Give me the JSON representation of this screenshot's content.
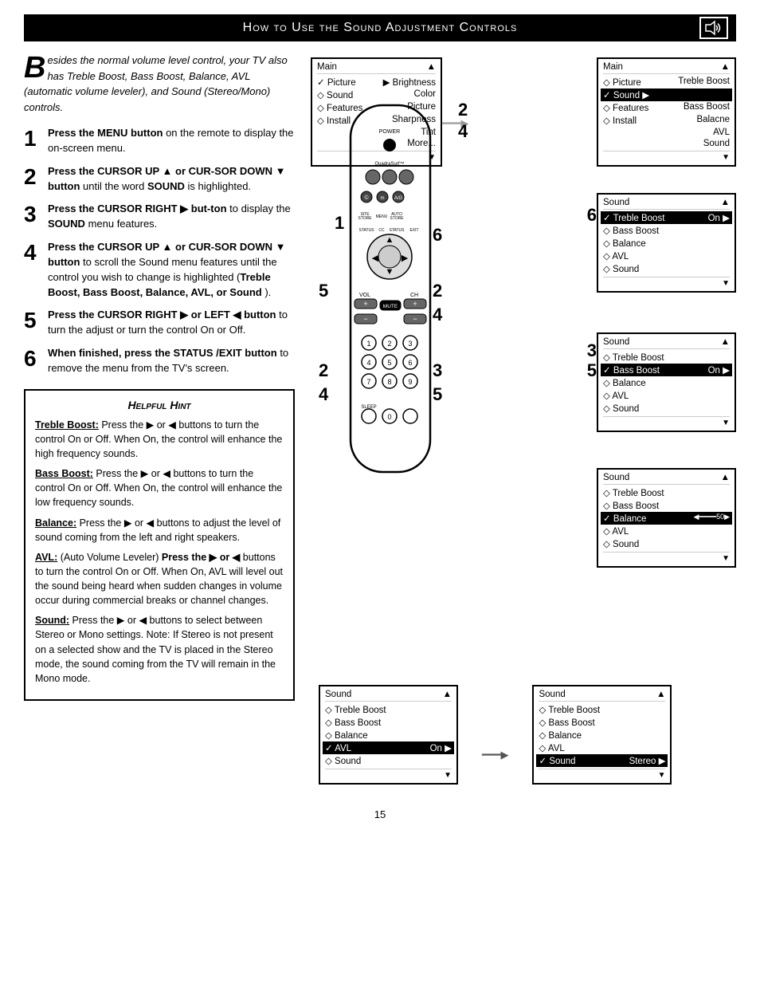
{
  "header": {
    "title": "How to Use the Sound Adjustment Controls",
    "icon_label": "sound-icon"
  },
  "intro": {
    "drop_cap": "B",
    "text": "esides the normal volume level control, your TV also has Treble Boost, Bass Boost, Balance, AVL (automatic volume leveler), and Sound (Stereo/Mono) controls."
  },
  "steps": [
    {
      "num": "1",
      "bold": "Press the MENU button",
      "rest": " on the remote to display the on-screen menu."
    },
    {
      "num": "2",
      "bold": "Press the CURSOR UP ▲ or CUR-SOR DOWN ▼ button",
      "rest": " until the word SOUND is highlighted."
    },
    {
      "num": "3",
      "bold": "Press the CURSOR RIGHT ▶ but-ton",
      "rest": " to display the SOUND menu features."
    },
    {
      "num": "4",
      "bold": "Press the CURSOR UP ▲ or CUR-SOR DOWN ▼ button",
      "rest": " to scroll the Sound menu features until the control you wish to change is highlighted (Treble Boost, Bass Boost, Balance, AVL, or Sound )."
    },
    {
      "num": "5",
      "bold": "Press the CURSOR RIGHT ▶ or LEFT ◀ button",
      "rest": " to turn the adjust or turn the control On or Off."
    },
    {
      "num": "6",
      "bold": "When finished, press the STATUS /EXIT button",
      "rest": " to remove the menu from the TV's screen."
    }
  ],
  "hint": {
    "title": "Helpful Hint",
    "items": [
      {
        "label": "Treble Boost:",
        "text": " Press the ▶ or ◀ buttons to turn the control On or Off. When On, the control will enhance the high frequency sounds."
      },
      {
        "label": "Bass Boost:",
        "text": " Press the ▶ or ◀ buttons to turn the control On or Off. When On, the control will enhance the low frequency sounds."
      },
      {
        "label": "Balance:",
        "text": " Press the ▶ or ◀ buttons to adjust the level of sound coming from the left and right speakers."
      },
      {
        "label": "AVL:",
        "text": " (Auto Volume Leveler) Press the ▶ or ◀ buttons to turn the control On or Off. When On, AVL will level out the sound being heard when sudden changes in volume occur during commercial breaks or channel changes."
      },
      {
        "label": "Sound:",
        "text": " Press the ▶ or ◀ buttons to select between Stereo or Mono settings. Note: If Stereo is not present on a selected show and the TV is placed in the Stereo mode, the sound coming from the TV will remain in the Mono mode."
      }
    ]
  },
  "menus": {
    "main_menu_1": {
      "title": "Main",
      "items": [
        {
          "label": "Picture",
          "value": "Brightness",
          "type": "arrow-right",
          "selected": false
        },
        {
          "label": "Sound",
          "value": "Color",
          "type": "diamond",
          "selected": false
        },
        {
          "label": "Features",
          "value": "Picture",
          "type": "diamond",
          "selected": false
        },
        {
          "label": "Install",
          "value": "Sharpness",
          "type": "diamond",
          "selected": false
        },
        {
          "label": "",
          "value": "Tint",
          "type": "",
          "selected": false
        },
        {
          "label": "",
          "value": "More...",
          "type": "",
          "selected": false
        }
      ]
    },
    "main_menu_2": {
      "title": "Main",
      "items": [
        {
          "label": "Picture",
          "value": "",
          "type": "diamond",
          "selected": false
        },
        {
          "label": "Sound",
          "value": "",
          "type": "checkmark",
          "selected": true
        },
        {
          "label": "Features",
          "value": "Treble Boost",
          "type": "diamond",
          "selected": false
        },
        {
          "label": "Install",
          "value": "Bass Boost",
          "type": "diamond",
          "selected": false
        },
        {
          "label": "",
          "value": "Balacne",
          "type": "",
          "selected": false
        },
        {
          "label": "",
          "value": "AVL",
          "type": "",
          "selected": false
        },
        {
          "label": "",
          "value": "Sound",
          "type": "",
          "selected": false
        }
      ]
    },
    "sound_menu_1": {
      "title": "Sound",
      "items": [
        {
          "label": "Treble Boost",
          "value": "On ▶",
          "type": "checkmark",
          "selected": true
        },
        {
          "label": "Bass Boost",
          "value": "",
          "type": "diamond",
          "selected": false
        },
        {
          "label": "Balance",
          "value": "",
          "type": "diamond",
          "selected": false
        },
        {
          "label": "AVL",
          "value": "",
          "type": "diamond",
          "selected": false
        },
        {
          "label": "Sound",
          "value": "",
          "type": "diamond",
          "selected": false
        }
      ]
    },
    "sound_menu_2": {
      "title": "Sound",
      "items": [
        {
          "label": "Treble Boost",
          "value": "",
          "type": "diamond",
          "selected": false
        },
        {
          "label": "Bass Boost",
          "value": "On ▶",
          "type": "checkmark",
          "selected": true
        },
        {
          "label": "Balance",
          "value": "",
          "type": "diamond",
          "selected": false
        },
        {
          "label": "AVL",
          "value": "",
          "type": "diamond",
          "selected": false
        },
        {
          "label": "Sound",
          "value": "",
          "type": "diamond",
          "selected": false
        }
      ]
    },
    "sound_menu_3": {
      "title": "Sound",
      "items": [
        {
          "label": "Treble Boost",
          "value": "",
          "type": "diamond",
          "selected": false
        },
        {
          "label": "Bass Boost",
          "value": "",
          "type": "diamond",
          "selected": false
        },
        {
          "label": "Balance",
          "value": "◀━━━━━━50▶",
          "type": "checkmark",
          "selected": true
        },
        {
          "label": "AVL",
          "value": "",
          "type": "diamond",
          "selected": false
        },
        {
          "label": "Sound",
          "value": "",
          "type": "diamond",
          "selected": false
        }
      ]
    },
    "sound_menu_avl": {
      "title": "Sound",
      "items": [
        {
          "label": "Treble Boost",
          "value": "",
          "type": "diamond",
          "selected": false
        },
        {
          "label": "Bass Boost",
          "value": "",
          "type": "diamond",
          "selected": false
        },
        {
          "label": "Balance",
          "value": "",
          "type": "diamond",
          "selected": false
        },
        {
          "label": "AVL",
          "value": "On ▶",
          "type": "checkmark",
          "selected": true
        },
        {
          "label": "Sound",
          "value": "",
          "type": "diamond",
          "selected": false
        }
      ]
    },
    "sound_menu_sound": {
      "title": "Sound",
      "items": [
        {
          "label": "Treble Boost",
          "value": "",
          "type": "diamond",
          "selected": false
        },
        {
          "label": "Bass Boost",
          "value": "",
          "type": "diamond",
          "selected": false
        },
        {
          "label": "Balance",
          "value": "",
          "type": "diamond",
          "selected": false
        },
        {
          "label": "AVL",
          "value": "",
          "type": "diamond",
          "selected": false
        },
        {
          "label": "Sound",
          "value": "Stereo ▶",
          "type": "checkmark",
          "selected": true
        }
      ]
    }
  },
  "page_number": "15"
}
